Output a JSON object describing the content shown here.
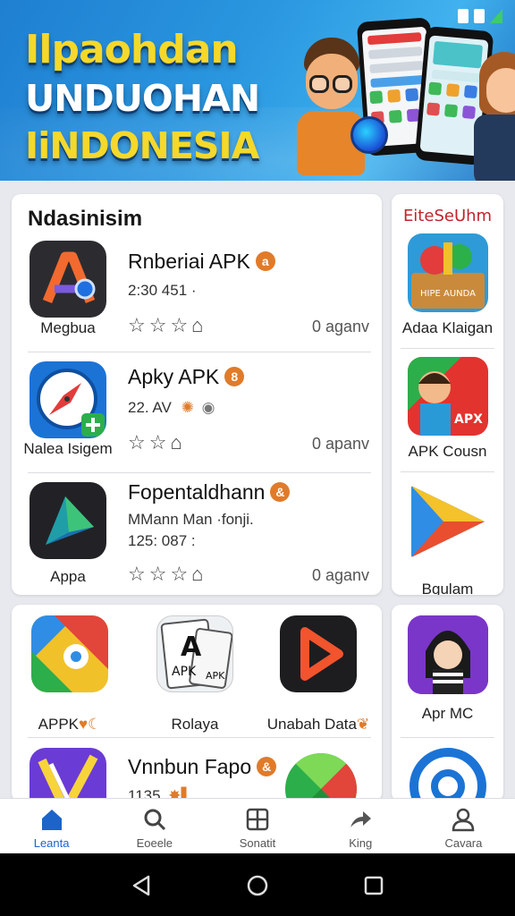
{
  "banner": {
    "line1": "Ilpaohdan",
    "line2": "UNDUOHAN",
    "line3": "IiNDONESIA"
  },
  "main_section": {
    "title": "Ndasinisim",
    "apps": [
      {
        "icon_caption": "Megbua",
        "name": "Rnberiai APK",
        "badge": "a",
        "sub": "",
        "meta": "2:30 451 ·",
        "age": "0 aganv",
        "icon": "arc-a-icon"
      },
      {
        "icon_caption": "Nalea Isigem",
        "name": "Apky APK",
        "badge": "8",
        "sub": "",
        "meta": "22. AV",
        "age": "0 apanv",
        "icon": "compass-icon"
      },
      {
        "icon_caption": "Appa",
        "name": "Fopentaldhann",
        "badge": "&",
        "sub": "MMann Man ·fonji.",
        "meta": "125: 087 :",
        "age": "0 aganv",
        "icon": "triangle-play-icon"
      }
    ]
  },
  "side_section": {
    "title": "EiteSeUhm",
    "items": [
      {
        "caption": "Adaa Klaigan",
        "icon": "game-box-icon",
        "icon_text": "HIPE AUNDA"
      },
      {
        "caption": "APK Cousn",
        "icon": "kid-character-icon",
        "icon_text": "APX"
      },
      {
        "caption": "Bgulam",
        "icon": "colorful-arrow-icon"
      }
    ]
  },
  "grid_section": {
    "cells": [
      {
        "caption": "APPK",
        "icon": "maps-pin-icon"
      },
      {
        "caption": "Rolaya",
        "icon": "apk-cards-icon",
        "icon_text": "A",
        "icon_text2": "APK",
        "icon_text3": "APK"
      },
      {
        "caption": "Unabah Data",
        "icon": "play-button-icon"
      }
    ],
    "partial_app": {
      "name": "Vnnbun Fapo",
      "badge": "&",
      "meta": "1135",
      "icon": "purple-v-icon"
    }
  },
  "side_section2": {
    "items": [
      {
        "caption": "Apr MC",
        "icon": "girl-character-icon"
      }
    ]
  },
  "bottom_nav": [
    {
      "label": "Leanta",
      "icon": "home-icon",
      "active": true
    },
    {
      "label": "Eoeele",
      "icon": "search-icon",
      "active": false
    },
    {
      "label": "Sonatit",
      "icon": "grid-icon",
      "active": false
    },
    {
      "label": "King",
      "icon": "share-arrow-icon",
      "active": false
    },
    {
      "label": "Cavara",
      "icon": "person-icon",
      "active": false
    }
  ],
  "colors": {
    "banner_blue": "#2a97e0",
    "banner_yellow": "#f5d82a",
    "accent_orange": "#e07b2a",
    "active_blue": "#1c64c8",
    "side_title_red": "#c2232c"
  }
}
